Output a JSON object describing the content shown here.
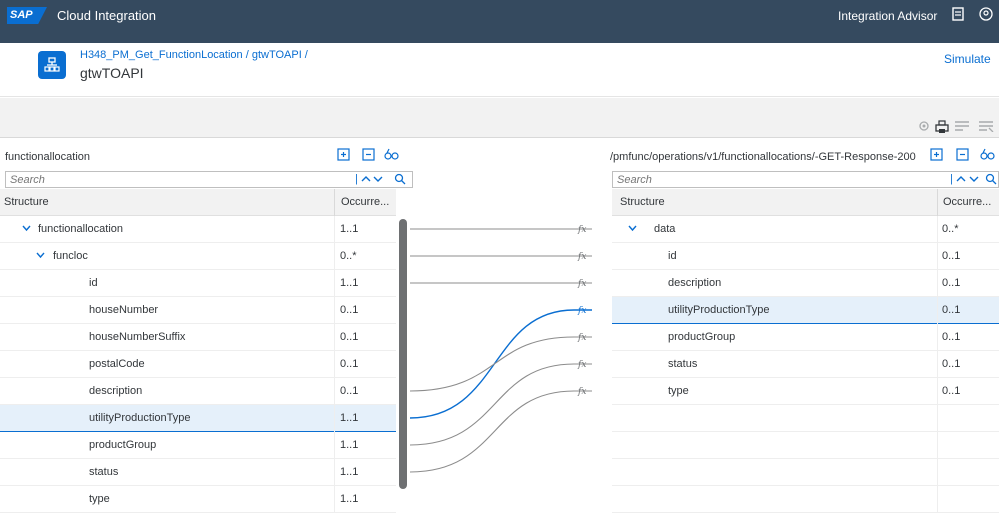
{
  "shell": {
    "logo": "SAP",
    "title": "Cloud Integration",
    "right_label": "Integration Advisor",
    "icons": [
      "notes-icon",
      "user-icon"
    ]
  },
  "header": {
    "breadcrumb_link": "H348_PM_Get_FunctionLocation / gtwTOAPI /",
    "title": "gtwTOAPI",
    "simulate": "Simulate"
  },
  "toolbar": {
    "icons": [
      "settings-icon",
      "print-icon",
      "align-icon",
      "delete-rows-icon"
    ]
  },
  "left": {
    "title": "functionallocation",
    "search_placeholder": "Search",
    "col_structure": "Structure",
    "col_occurrence": "Occurre...",
    "rows": [
      {
        "name": "functionallocation",
        "occ": "1..1",
        "expanded": true
      },
      {
        "name": "funcloc",
        "occ": "0..*",
        "expanded": true
      },
      {
        "name": "id",
        "occ": "1..1"
      },
      {
        "name": "houseNumber",
        "occ": "0..1"
      },
      {
        "name": "houseNumberSuffix",
        "occ": "0..1"
      },
      {
        "name": "postalCode",
        "occ": "0..1"
      },
      {
        "name": "description",
        "occ": "0..1"
      },
      {
        "name": "utilityProductionType",
        "occ": "1..1",
        "selected": true
      },
      {
        "name": "productGroup",
        "occ": "1..1"
      },
      {
        "name": "status",
        "occ": "1..1"
      },
      {
        "name": "type",
        "occ": "1..1"
      }
    ]
  },
  "right": {
    "title": "/pmfunc/operations/v1/functionallocations/-GET-Response-200",
    "search_placeholder": "Search",
    "col_structure": "Structure",
    "col_occurrence": "Occurre...",
    "rows": [
      {
        "name": "data",
        "occ": "0..*",
        "expanded": true
      },
      {
        "name": "id",
        "occ": "0..1"
      },
      {
        "name": "description",
        "occ": "0..1"
      },
      {
        "name": "utilityProductionType",
        "occ": "0..1",
        "selected": true
      },
      {
        "name": "productGroup",
        "occ": "0..1"
      },
      {
        "name": "status",
        "occ": "0..1"
      },
      {
        "name": "type",
        "occ": "0..1"
      }
    ]
  },
  "mapping": {
    "function_glyph": "fx",
    "link_color": "#8c8c8c",
    "selected_link_color": "#0a6ed1",
    "links": [
      {
        "from": "functionallocation",
        "to": "data"
      },
      {
        "from": "funcloc",
        "to": "id"
      },
      {
        "from": "id",
        "to": "description"
      },
      {
        "from": "utilityProductionType",
        "to": "utilityProductionType",
        "selected": true
      },
      {
        "from": "description",
        "to": "productGroup"
      },
      {
        "from": "productGroup",
        "to": "status"
      },
      {
        "from": "status",
        "to": "type"
      }
    ]
  },
  "colors": {
    "shell": "#354a5f",
    "accent": "#0a6ed1",
    "selection": "#e5f0fa"
  }
}
